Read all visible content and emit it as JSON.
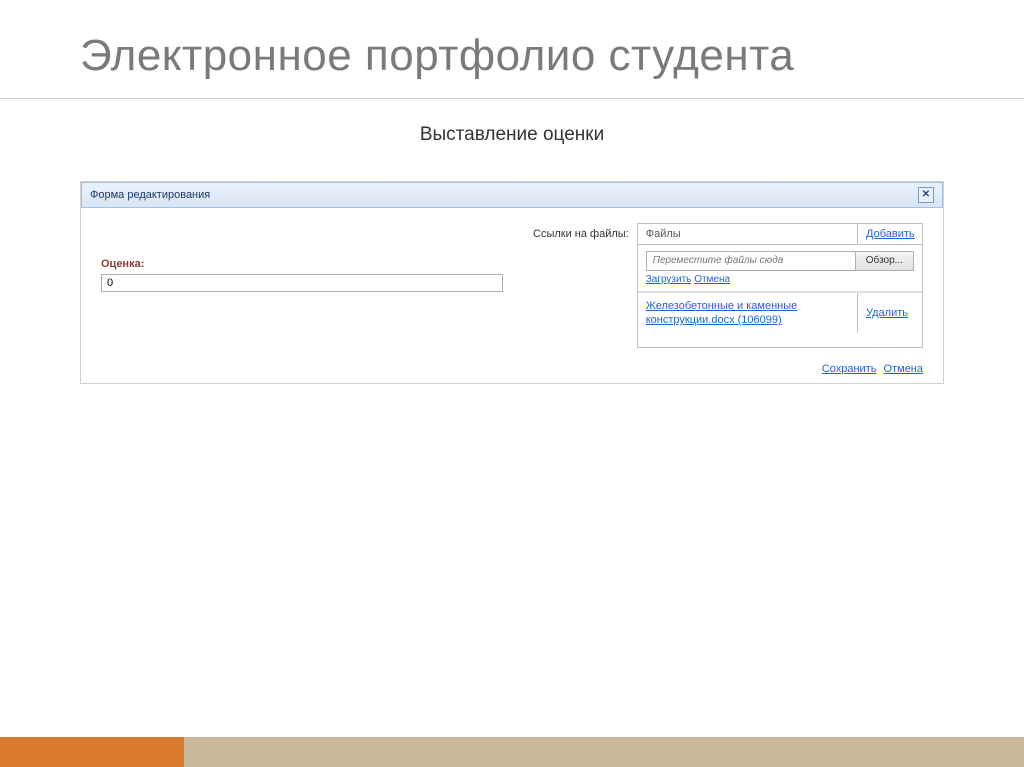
{
  "slide": {
    "title": "Электронное портфолио студента",
    "subtitle": "Выставление оценки"
  },
  "form": {
    "titlebar": "Форма редактирования",
    "grade_label": "Оценка:",
    "grade_value": "0",
    "files_label": "Ссылки на файлы:",
    "files_header": "Файлы",
    "add_link": "Добавить",
    "drop_placeholder": "Переместите файлы сюда",
    "browse_btn": "Обзор...",
    "upload_link": "Загрузить",
    "upload_cancel": "Отмена",
    "file_name": "Железобетонные и каменные конструкции.docx (106099)",
    "delete_link": "Удалить",
    "save_link": "Сохранить",
    "cancel_link": "Отмена"
  }
}
